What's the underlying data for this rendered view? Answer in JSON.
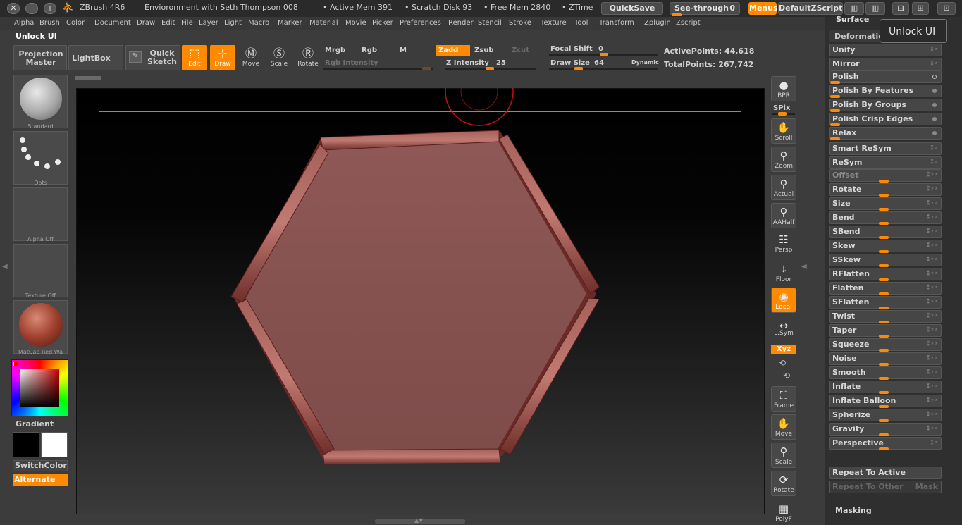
{
  "titlebar": {
    "app_name": "ZBrush 4R6",
    "document": "Envioronment with Seth Thompson 008",
    "active_mem": "• Active Mem 391",
    "scratch_disk": "• Scratch Disk 93",
    "free_mem": "• Free Mem 2840",
    "ztime": "• ZTime",
    "quicksave": "QuickSave",
    "see_through_label": "See-through",
    "see_through_value": "0",
    "menus": "Menus",
    "default_zscript": "DefaultZScript"
  },
  "menubar": [
    "Alpha",
    "Brush",
    "Color",
    "Document",
    "Draw",
    "Edit",
    "File",
    "Layer",
    "Light",
    "Macro",
    "Marker",
    "Material",
    "Movie",
    "Picker",
    "Preferences",
    "Render",
    "Stencil",
    "Stroke",
    "Texture",
    "Tool",
    "Transform",
    "Zplugin",
    "Zscript"
  ],
  "unlock_ui_left": "Unlock UI",
  "unlock_ui_tooltip": "Unlock UI",
  "toolbar": {
    "projection_master": "Projection Master",
    "lightbox": "LightBox",
    "quick_sketch": "Quick Sketch",
    "edit": "Edit",
    "draw": "Draw",
    "move": "Move",
    "scale": "Scale",
    "rotate": "Rotate",
    "mrgb": "Mrgb",
    "rgb": "Rgb",
    "m": "M",
    "zadd": "Zadd",
    "zsub": "Zsub",
    "zcut": "Zcut",
    "rgb_intensity": "Rgb Intensity",
    "z_intensity_label": "Z Intensity",
    "z_intensity_value": "25",
    "focal_shift_label": "Focal Shift",
    "focal_shift_value": "0",
    "draw_size_label": "Draw Size",
    "draw_size_value": "64",
    "dynamic": "Dynamic",
    "active_points": "ActivePoints: 44,618",
    "total_points": "TotalPoints: 267,742"
  },
  "leftshelf": {
    "brush": "Standard",
    "stroke": "Dots",
    "alpha": "Alpha Off",
    "texture": "Texture Off",
    "material": "MatCap Red Wa",
    "gradient": "Gradient",
    "switchcolor": "SwitchColor",
    "alternate": "Alternate"
  },
  "rightdock": {
    "bpr": "BPR",
    "spix": "SPix",
    "scroll": "Scroll",
    "zoom": "Zoom",
    "actual": "Actual",
    "aahalf": "AAHalf",
    "persp": "Persp",
    "floor": "Floor",
    "local": "Local",
    "lsym": "L.Sym",
    "xyz": "Xyz",
    "frame": "Frame",
    "move": "Move",
    "scale": "Scale",
    "rotate": "Rotate",
    "polyf": "PolyF"
  },
  "panel": {
    "surface": "Surface",
    "deformation": "Deformation",
    "items": [
      "Unify",
      "Mirror",
      "Polish",
      "Polish By Features",
      "Polish By Groups",
      "Polish Crisp Edges",
      "Relax",
      "Smart ReSym",
      "ReSym",
      "Offset",
      "Rotate",
      "Size",
      "Bend",
      "SBend",
      "Skew",
      "SSkew",
      "RFlatten",
      "Flatten",
      "SFlatten",
      "Twist",
      "Taper",
      "Squeeze",
      "Noise",
      "Smooth",
      "Inflate",
      "Inflate Balloon",
      "Spherize",
      "Gravity",
      "Perspective"
    ],
    "repeat_to_active": "Repeat To Active",
    "repeat_to_other": "Repeat To Other",
    "mask": "Mask",
    "masking": "Masking"
  },
  "colors": {
    "accent": "#ff8a00",
    "mesh": "#8a4a47",
    "background": "#3c3c3c"
  }
}
